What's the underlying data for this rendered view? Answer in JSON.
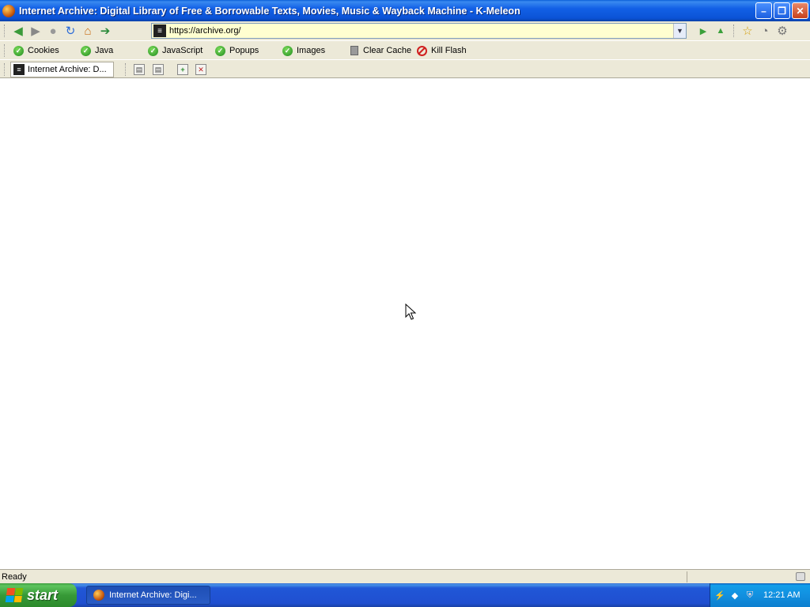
{
  "window": {
    "title": "Internet Archive: Digital Library of Free & Borrowable Texts, Movies, Music & Wayback Machine - K-Meleon",
    "controls": {
      "minimize": "–",
      "restore": "❐",
      "close": "✕"
    }
  },
  "nav": {
    "back_icon": "◀",
    "forward_icon": "▶",
    "stop_icon": "●",
    "reload_icon": "↻",
    "home_icon": "⌂",
    "go_icon": "➔",
    "url": "https://archive.org/",
    "site_icon": "≡",
    "dropdown_icon": "▼",
    "go_button_icon": "▶",
    "up_icon": "▲",
    "bookmark_icon": "☆",
    "history_icon": "◔",
    "settings_icon": "⚙"
  },
  "privacy": {
    "items": [
      {
        "label": "Cookies",
        "state": "enabled"
      },
      {
        "label": "Java",
        "state": "enabled"
      },
      {
        "label": "JavaScript",
        "state": "enabled"
      },
      {
        "label": "Popups",
        "state": "enabled"
      },
      {
        "label": "Images",
        "state": "enabled"
      }
    ],
    "clear_cache": "Clear Cache",
    "kill_flash": "Kill Flash",
    "check_glyph": "✓"
  },
  "tabs": {
    "items": [
      {
        "label": "Internet Archive: D..."
      }
    ],
    "buttons": {
      "prev": "▤",
      "next": "▤",
      "new": "+",
      "close": "✕"
    }
  },
  "status": {
    "text": "Ready"
  },
  "taskbar": {
    "start_label": "start",
    "window_item": "Internet Archive: Digi...",
    "clock": "12:21 AM",
    "tray_icons": [
      "network-icon",
      "security-icon",
      "shield-icon"
    ]
  },
  "colors": {
    "title_bar": "#0b53d6",
    "toolbar_bg": "#ece9d8",
    "url_bg": "#ffffd0",
    "taskbar": "#1f4fd0",
    "start_green": "#379a37"
  }
}
